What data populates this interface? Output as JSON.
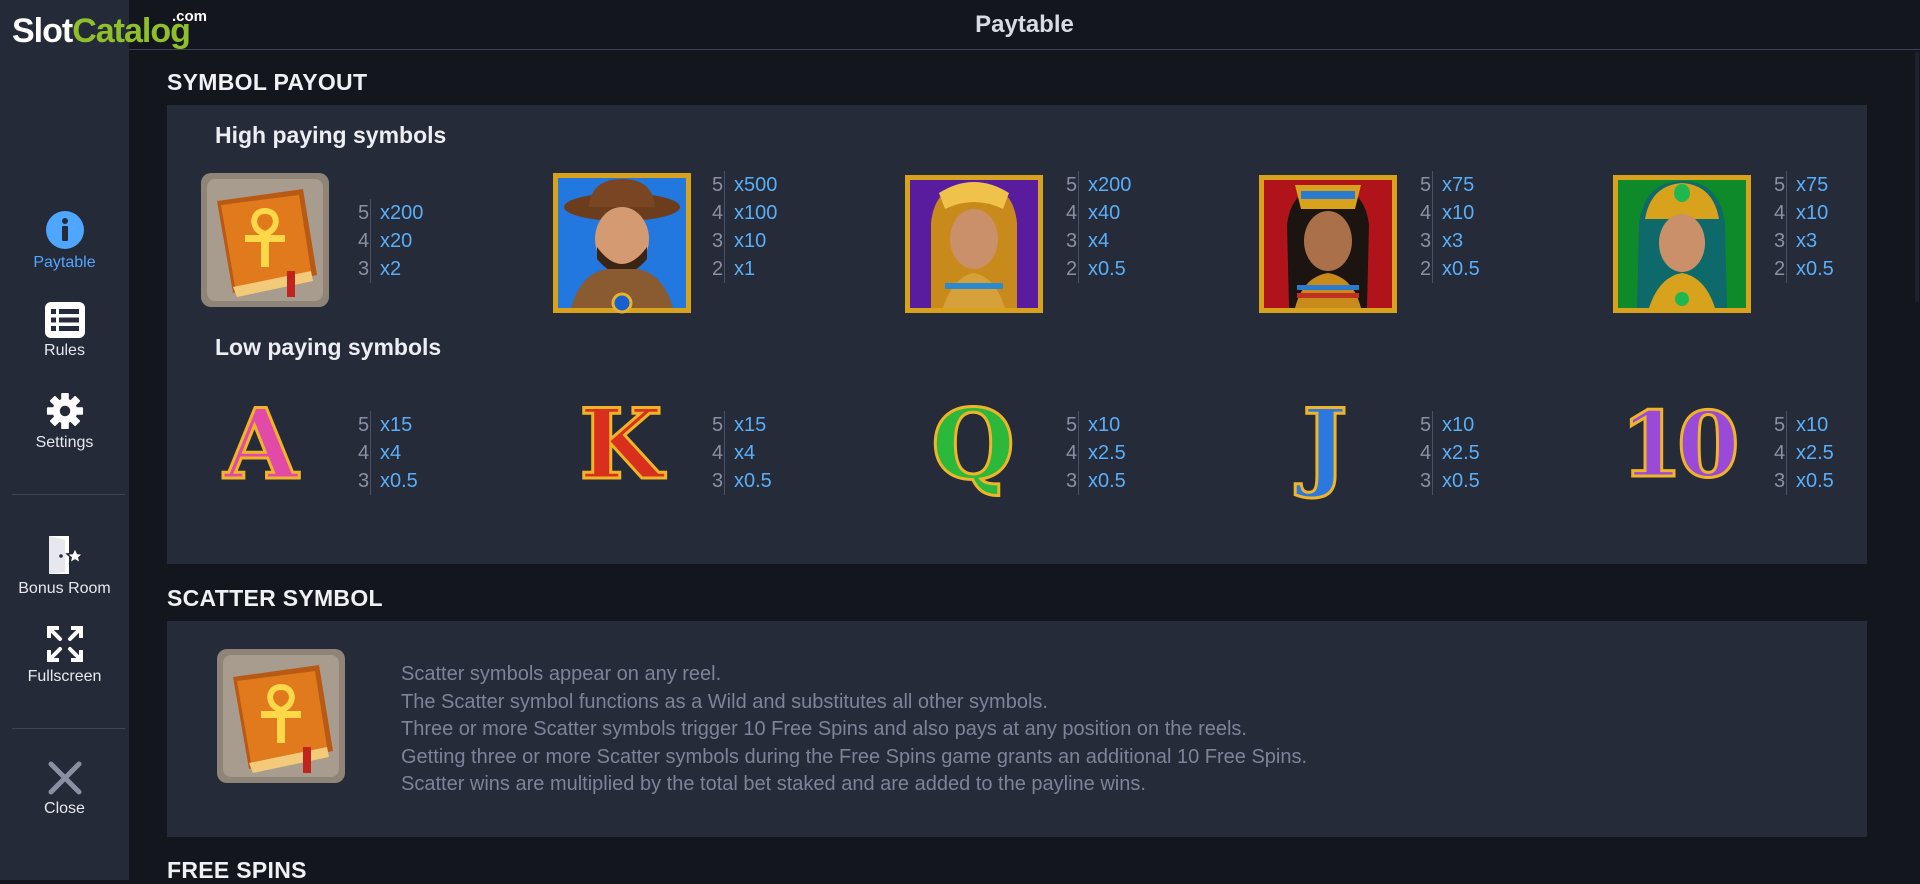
{
  "logo": {
    "slot": "Slot",
    "catalog": "Catalog",
    "com": ".com"
  },
  "header": {
    "title": "Paytable"
  },
  "sidebar": {
    "items": [
      {
        "label": "Paytable",
        "icon": "info-icon",
        "active": true
      },
      {
        "label": "Rules",
        "icon": "list-icon"
      },
      {
        "label": "Settings",
        "icon": "gear-icon"
      },
      {
        "label": "Bonus Room",
        "icon": "door-star-icon"
      },
      {
        "label": "Fullscreen",
        "icon": "expand-icon"
      },
      {
        "label": "Close",
        "icon": "close-icon"
      }
    ]
  },
  "symbol_payout": {
    "title": "SYMBOL PAYOUT",
    "high_heading": "High paying symbols",
    "low_heading": "Low paying symbols",
    "high": [
      {
        "name": "book",
        "pays": [
          {
            "count": "5",
            "value": "x200"
          },
          {
            "count": "4",
            "value": "x20"
          },
          {
            "count": "3",
            "value": "x2"
          }
        ]
      },
      {
        "name": "explorer",
        "pays": [
          {
            "count": "5",
            "value": "x500"
          },
          {
            "count": "4",
            "value": "x100"
          },
          {
            "count": "3",
            "value": "x10"
          },
          {
            "count": "2",
            "value": "x1"
          }
        ]
      },
      {
        "name": "cleopatra-purple",
        "pays": [
          {
            "count": "5",
            "value": "x200"
          },
          {
            "count": "4",
            "value": "x40"
          },
          {
            "count": "3",
            "value": "x4"
          },
          {
            "count": "2",
            "value": "x0.5"
          }
        ]
      },
      {
        "name": "queen-red",
        "pays": [
          {
            "count": "5",
            "value": "x75"
          },
          {
            "count": "4",
            "value": "x10"
          },
          {
            "count": "3",
            "value": "x3"
          },
          {
            "count": "2",
            "value": "x0.5"
          }
        ]
      },
      {
        "name": "queen-green",
        "pays": [
          {
            "count": "5",
            "value": "x75"
          },
          {
            "count": "4",
            "value": "x10"
          },
          {
            "count": "3",
            "value": "x3"
          },
          {
            "count": "2",
            "value": "x0.5"
          }
        ]
      }
    ],
    "low": [
      {
        "name": "A",
        "letter": "A",
        "pays": [
          {
            "count": "5",
            "value": "x15"
          },
          {
            "count": "4",
            "value": "x4"
          },
          {
            "count": "3",
            "value": "x0.5"
          }
        ]
      },
      {
        "name": "K",
        "letter": "K",
        "pays": [
          {
            "count": "5",
            "value": "x15"
          },
          {
            "count": "4",
            "value": "x4"
          },
          {
            "count": "3",
            "value": "x0.5"
          }
        ]
      },
      {
        "name": "Q",
        "letter": "Q",
        "pays": [
          {
            "count": "5",
            "value": "x10"
          },
          {
            "count": "4",
            "value": "x2.5"
          },
          {
            "count": "3",
            "value": "x0.5"
          }
        ]
      },
      {
        "name": "J",
        "letter": "J",
        "pays": [
          {
            "count": "5",
            "value": "x10"
          },
          {
            "count": "4",
            "value": "x2.5"
          },
          {
            "count": "3",
            "value": "x0.5"
          }
        ]
      },
      {
        "name": "10",
        "letter": "10",
        "pays": [
          {
            "count": "5",
            "value": "x10"
          },
          {
            "count": "4",
            "value": "x2.5"
          },
          {
            "count": "3",
            "value": "x0.5"
          }
        ]
      }
    ]
  },
  "scatter": {
    "title": "SCATTER SYMBOL",
    "lines": [
      "Scatter symbols appear on any reel.",
      "The Scatter symbol functions as a Wild and substitutes all other symbols.",
      "Three or more Scatter symbols trigger 10 Free Spins and also pays at any position on the reels.",
      "Getting three or more Scatter symbols during the Free Spins game grants an additional 10 Free Spins.",
      "Scatter wins are multiplied by the total bet staked and are added to the payline wins."
    ]
  },
  "free_spins": {
    "title": "FREE SPINS"
  },
  "colors": {
    "accent": "#4fa6ff",
    "payout_value": "#5aaef6",
    "panel": "#262b3a",
    "sidebar": "#252a38"
  }
}
